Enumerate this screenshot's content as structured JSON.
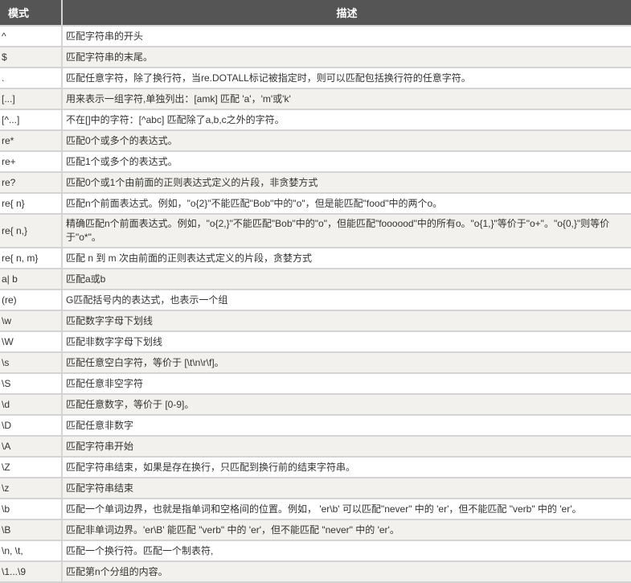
{
  "header": {
    "pattern": "模式",
    "description": "描述"
  },
  "rows": [
    {
      "pattern": "^",
      "description": "匹配字符串的开头"
    },
    {
      "pattern": "$",
      "description": "匹配字符串的末尾。"
    },
    {
      "pattern": ".",
      "description": "匹配任意字符，除了换行符，当re.DOTALL标记被指定时，则可以匹配包括换行符的任意字符。"
    },
    {
      "pattern": "[...]",
      "description": "用来表示一组字符,单独列出：[amk] 匹配 'a'，'m'或'k'"
    },
    {
      "pattern": "[^...]",
      "description": "不在[]中的字符：[^abc] 匹配除了a,b,c之外的字符。"
    },
    {
      "pattern": "re*",
      "description": "匹配0个或多个的表达式。"
    },
    {
      "pattern": "re+",
      "description": "匹配1个或多个的表达式。"
    },
    {
      "pattern": "re?",
      "description": "匹配0个或1个由前面的正则表达式定义的片段，非贪婪方式"
    },
    {
      "pattern": "re{ n}",
      "description": "匹配n个前面表达式。例如，\"o{2}\"不能匹配\"Bob\"中的\"o\"，但是能匹配\"food\"中的两个o。"
    },
    {
      "pattern": "re{ n,}",
      "description": "精确匹配n个前面表达式。例如，\"o{2,}\"不能匹配\"Bob\"中的\"o\"，但能匹配\"foooood\"中的所有o。\"o{1,}\"等价于\"o+\"。\"o{0,}\"则等价于\"o*\"。"
    },
    {
      "pattern": "re{ n, m}",
      "description": "匹配 n 到 m 次由前面的正则表达式定义的片段，贪婪方式"
    },
    {
      "pattern": "a| b",
      "description": "匹配a或b"
    },
    {
      "pattern": "(re)",
      "description": "G匹配括号内的表达式，也表示一个组"
    },
    {
      "pattern": "\\w",
      "description": "匹配数字字母下划线"
    },
    {
      "pattern": "\\W",
      "description": "匹配非数字字母下划线"
    },
    {
      "pattern": "\\s",
      "description": "匹配任意空白字符，等价于 [\\t\\n\\r\\f]。"
    },
    {
      "pattern": "\\S",
      "description": "匹配任意非空字符"
    },
    {
      "pattern": "\\d",
      "description": "匹配任意数字，等价于 [0-9]。"
    },
    {
      "pattern": "\\D",
      "description": "匹配任意非数字"
    },
    {
      "pattern": "\\A",
      "description": "匹配字符串开始"
    },
    {
      "pattern": "\\Z",
      "description": "匹配字符串结束，如果是存在换行，只匹配到换行前的结束字符串。"
    },
    {
      "pattern": "\\z",
      "description": "匹配字符串结束"
    },
    {
      "pattern": "\\b",
      "description": "匹配一个单词边界，也就是指单词和空格间的位置。例如， 'er\\b' 可以匹配\"never\" 中的 'er'，但不能匹配 \"verb\" 中的 'er'。"
    },
    {
      "pattern": "\\B",
      "description": "匹配非单词边界。'er\\B' 能匹配 \"verb\" 中的 'er'，但不能匹配 \"never\" 中的 'er'。"
    },
    {
      "pattern": "\\n, \\t,",
      "description": "匹配一个换行符。匹配一个制表符,"
    },
    {
      "pattern": "\\1...\\9",
      "description": "匹配第n个分组的内容。"
    }
  ]
}
